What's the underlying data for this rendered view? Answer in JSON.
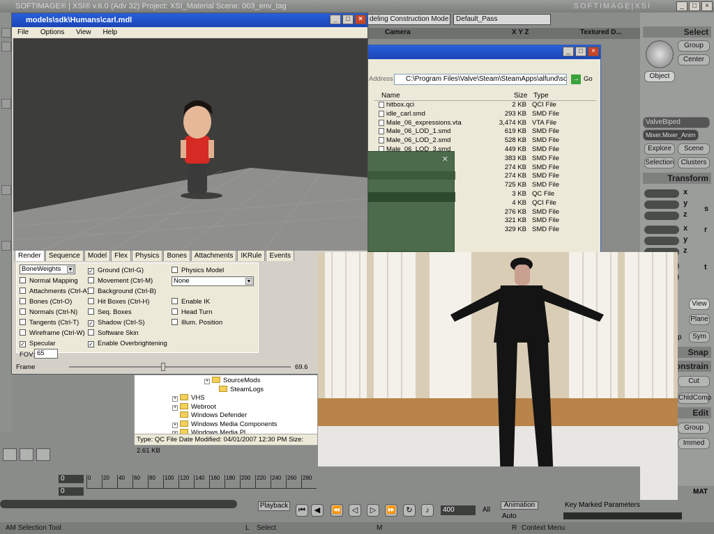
{
  "xsi": {
    "title": "SOFTIMAGE® | XSI® v.6.0 (Adv 32) Project: XSI_Material    Scene: 003_env_tag",
    "brand": "SOFTIMAGE|XSI",
    "mode_combo": "deling Construction Mode",
    "pass_combo": "Default_Pass",
    "viewport": {
      "camera": "Camera",
      "axes": "X Y Z",
      "display": "Textured D..."
    }
  },
  "right_panel": {
    "select_header": "Select",
    "group": "Group",
    "center": "Center",
    "object": "Object",
    "valve_biped": "ValveBiped",
    "mixer": "Mixer.Mixer_Anim",
    "explore": "Explore",
    "scene": "Scene",
    "selection": "Selection",
    "clusters": "Clusters",
    "transform_header": "Transform",
    "x": "x",
    "y": "y",
    "z": "z",
    "view": "View",
    "plane": "Plane",
    "sym": "Sym",
    "snap_header": "Snap",
    "constrain_header": "onstrain",
    "cut": "Cut",
    "chldcomp": "ChldComp",
    "edit_header": "Edit",
    "group2": "Group",
    "immed": "Immed",
    "mat": "MAT",
    "p": "p",
    "t": "t",
    "s": "s",
    "r": "r"
  },
  "explorer": {
    "address_label": "Address",
    "address": "C:\\Program Files\\Valve\\Steam\\SteamApps\\alfund\\sourc",
    "go": "Go",
    "columns": {
      "name": "Name",
      "size": "Size",
      "type": "Type"
    },
    "files": [
      {
        "name": "hitbox.qci",
        "size": "2 KB",
        "type": "QCI File"
      },
      {
        "name": "idle_carl.smd",
        "size": "293 KB",
        "type": "SMD File"
      },
      {
        "name": "Male_06_expressions.vta",
        "size": "3,474 KB",
        "type": "VTA File"
      },
      {
        "name": "Male_06_LOD_1.smd",
        "size": "619 KB",
        "type": "SMD File"
      },
      {
        "name": "Male_06_LOD_2.smd",
        "size": "528 KB",
        "type": "SMD File"
      },
      {
        "name": "Male_06_LOD_3.smd",
        "size": "449 KB",
        "type": "SMD File"
      },
      {
        "name": "",
        "size": "383 KB",
        "type": "SMD File"
      },
      {
        "name": "",
        "size": "274 KB",
        "type": "SMD File"
      },
      {
        "name": "md",
        "size": "274 KB",
        "type": "SMD File"
      },
      {
        "name": "",
        "size": "725 KB",
        "type": "SMD File"
      },
      {
        "name": "",
        "size": "3 KB",
        "type": "QC File"
      },
      {
        "name": "",
        "size": "4 KB",
        "type": "QCI File"
      },
      {
        "name": "",
        "size": "276 KB",
        "type": "SMD File"
      },
      {
        "name": "",
        "size": "321 KB",
        "type": "SMD File"
      },
      {
        "name": "",
        "size": "329 KB",
        "type": "SMD File"
      }
    ]
  },
  "hlmv": {
    "title": "models\\sdk\\Humans\\carl.mdl",
    "menu": [
      "File",
      "Options",
      "View",
      "Help"
    ],
    "tabs": [
      "Render",
      "Sequence",
      "Model",
      "Flex",
      "Physics",
      "Bones",
      "Attachments",
      "IKRule",
      "Events"
    ],
    "render_mode": "BoneWeights",
    "col1": [
      {
        "label": "Normal Mapping",
        "checked": false
      },
      {
        "label": "Attachments (Ctrl-A)",
        "checked": false
      },
      {
        "label": "Bones (Ctrl-O)",
        "checked": false
      },
      {
        "label": "Normals (Ctrl-N)",
        "checked": false
      },
      {
        "label": "Tangents (Ctrl-T)",
        "checked": false
      },
      {
        "label": "Wireframe (Ctrl-W)",
        "checked": false
      },
      {
        "label": "Specular",
        "checked": true
      }
    ],
    "col2": [
      {
        "label": "Ground (Ctrl-G)",
        "checked": true
      },
      {
        "label": "Movement (Ctrl-M)",
        "checked": false
      },
      {
        "label": "Background (Ctrl-B)",
        "checked": false
      },
      {
        "label": "Hit Boxes (Ctrl-H)",
        "checked": false
      },
      {
        "label": "Seq. Boxes",
        "checked": false
      },
      {
        "label": "Shadow (Ctrl-S)",
        "checked": true
      },
      {
        "label": "Software Skin",
        "checked": false
      },
      {
        "label": "Enable Overbrightening",
        "checked": true
      }
    ],
    "physics_model": "Physics Model",
    "physics_select": "None",
    "col3": [
      {
        "label": "Enable IK",
        "checked": false
      },
      {
        "label": "Head Turn",
        "checked": false
      },
      {
        "label": "Illum. Position",
        "checked": false
      }
    ],
    "fov_label": "FOV:",
    "fov_value": "65",
    "frame_label": "Frame",
    "frame_value": "69.6"
  },
  "tree": {
    "items": [
      {
        "label": "SourceMods",
        "plus": true
      },
      {
        "label": "SteamLogs",
        "plus": false
      },
      {
        "label": "VHS",
        "plus": true
      },
      {
        "label": "Webroot",
        "plus": true
      },
      {
        "label": "Windows Defender",
        "plus": false
      },
      {
        "label": "Windows Media Components",
        "plus": true
      },
      {
        "label": "Windows Media Pl...",
        "plus": true
      }
    ],
    "status": "Type: QC File Date Modified: 04/01/2007 12:30 PM Size: 2.61 KB"
  },
  "timeline": {
    "start": "0",
    "current": "0",
    "ticks": [
      "0",
      "20",
      "40",
      "60",
      "80",
      "100",
      "120",
      "140",
      "160",
      "180",
      "200",
      "220",
      "240",
      "260",
      "280"
    ],
    "end_frame": "400",
    "all": "All",
    "playback": "Playback",
    "animation": "Animation",
    "auto": "Auto",
    "key_marked": "Key Marked Parameters"
  },
  "status": {
    "tool": "AM Selection Tool",
    "l_label": "L",
    "l_text": "Select",
    "m_label": "M",
    "r_label": "R",
    "r_text": "Context Menu"
  }
}
